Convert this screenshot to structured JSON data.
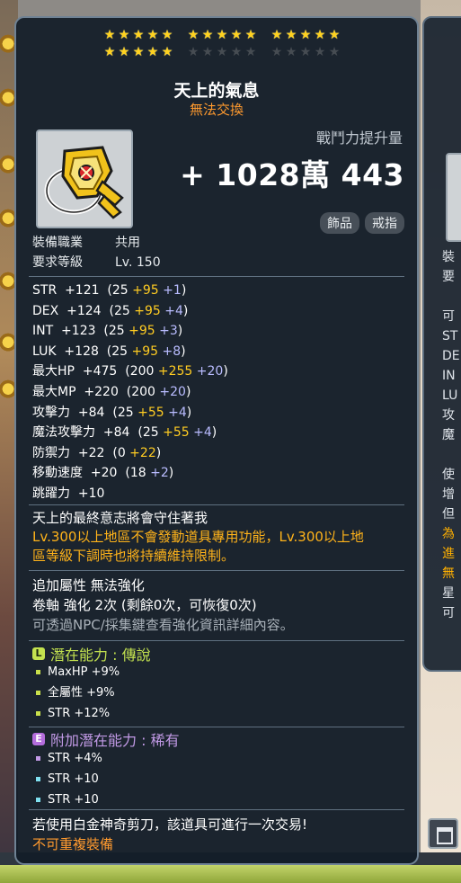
{
  "item": {
    "name": "天上的氣息",
    "trade": "無法交換",
    "power_label": "戰鬥力提升量",
    "power_value": "+ 1028萬 443",
    "tags": [
      "飾品",
      "戒指"
    ],
    "stars": {
      "filled": 20,
      "total": 30
    }
  },
  "requirements": {
    "job_label": "裝備職業",
    "job_value": "共用",
    "level_label": "要求等級",
    "level_value": "Lv. 150"
  },
  "stats": [
    {
      "name": "STR",
      "total": "+121",
      "base": "25",
      "flame": "+95",
      "star": "+1"
    },
    {
      "name": "DEX",
      "total": "+124",
      "base": "25",
      "flame": "+95",
      "star": "+4"
    },
    {
      "name": "INT",
      "total": "+123",
      "base": "25",
      "flame": "+95",
      "star": "+3"
    },
    {
      "name": "LUK",
      "total": "+128",
      "base": "25",
      "flame": "+95",
      "star": "+8"
    },
    {
      "name": "最大HP",
      "total": "+475",
      "base": "200",
      "flame": "+255",
      "star": "+20"
    },
    {
      "name": "最大MP",
      "total": "+220",
      "base": "200",
      "flame": "",
      "star": "+20"
    },
    {
      "name": "攻擊力",
      "total": "+84",
      "base": "25",
      "flame": "+55",
      "star": "+4"
    },
    {
      "name": "魔法攻擊力",
      "total": "+84",
      "base": "25",
      "flame": "+55",
      "star": "+4"
    },
    {
      "name": "防禦力",
      "total": "+22",
      "base": "0",
      "flame": "+22",
      "star": ""
    },
    {
      "name": "移動速度",
      "total": "+20",
      "base": "18",
      "flame": "",
      "star": "+2"
    },
    {
      "name": "跳躍力",
      "total": "+10",
      "base": "",
      "flame": "",
      "star": ""
    }
  ],
  "description": {
    "flavor": "天上的最終意志將會守住著我",
    "note_line1": "Lv.300以上地區不會發動道具專用功能，Lv.300以上地",
    "note_line2": "區等級下調時也將持續維持限制。"
  },
  "extra": {
    "additional": "追加屬性 無法強化",
    "scroll": "卷軸 強化 2次 (剩餘0次，可恢復0次)",
    "hint": "可透過NPC/採集鍵查看強化資訊詳細內容。"
  },
  "potential": {
    "badge": "L",
    "label": "潛在能力 : 傳說",
    "color": "#c3e24f",
    "lines": [
      "MaxHP +9%",
      "全屬性 +9%",
      "STR +12%"
    ]
  },
  "bonus_potential": {
    "badge": "E",
    "label": "附加潛在能力 : 稀有",
    "color": "#c29ae6",
    "lines": [
      "STR +4%",
      "STR +10",
      "STR +10"
    ]
  },
  "footer": {
    "line1": "若使用白金神奇剪刀，該道具可進行一次交易!",
    "line2": "不可重複裝備"
  }
}
